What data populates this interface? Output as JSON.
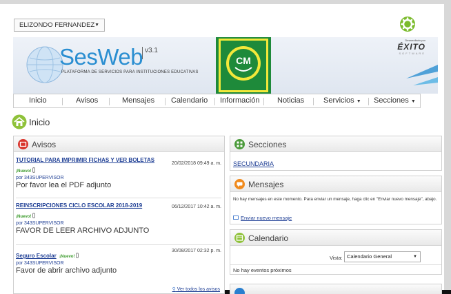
{
  "user_select": {
    "value": "ELIZONDO FERNANDEZ"
  },
  "banner": {
    "brand": "SesWeb",
    "version": "v3.1",
    "subtitle": "PLATAFORMA DE SERVICIOS PARA INSTITUCIONES EDUCATIVAS",
    "school_logo_text": "CM",
    "developer_small": "Desarrollado por",
    "developer": "ÉXITO",
    "developer_tag": "SOFTWARE"
  },
  "nav": {
    "items": [
      {
        "label": "Inicio"
      },
      {
        "label": "Avisos"
      },
      {
        "label": "Mensajes"
      },
      {
        "label": "Calendario"
      },
      {
        "label": "Información"
      },
      {
        "label": "Noticias"
      },
      {
        "label": "Servicios"
      },
      {
        "label": "Secciones"
      }
    ]
  },
  "page_title": "Inicio",
  "avisos": {
    "title": "Avisos",
    "items": [
      {
        "title": "TUTORIAL PARA IMPRIMIR FICHAS Y VER BOLETAS",
        "badge": "¡Nuevo!",
        "date": "20/02/2018 09:49 a. m.",
        "author": "por 343SUPERVISOR",
        "body": "Por favor lea el PDF adjunto"
      },
      {
        "title": "REINSCRIPCIONES CICLO ESCOLAR 2018-2019",
        "badge": "¡Nuevo!",
        "date": "06/12/2017 10:42 a. m.",
        "author": "por 343SUPERVISOR",
        "body": "FAVOR DE LEER ARCHIVO ADJUNTO"
      },
      {
        "title": "Seguro Escolar",
        "badge": "¡Nuevo!",
        "date": "30/08/2017 02:32 p. m.",
        "author": "por 343SUPERVISOR",
        "body": "Favor de abrir archivo adjunto"
      }
    ],
    "view_all": "Ver todos los avisos"
  },
  "secciones": {
    "title": "Secciones",
    "link": "SECUNDARIA"
  },
  "mensajes": {
    "title": "Mensajes",
    "text": "No hay mensajes en este momento. Para enviar un mensaje, haga clic en \"Enviar nuevo mensaje\", abajo.",
    "link": "Enviar nuevo mensaje"
  },
  "calendario": {
    "title": "Calendario",
    "vista_label": "Vista:",
    "vista_value": "Calendario General",
    "empty": "No hay eventos próximos"
  },
  "colors": {
    "brand_blue": "#2a8ed1",
    "link_blue": "#1f3f95",
    "new_green": "#3a9a2a",
    "school_green": "#1e8a3a"
  }
}
